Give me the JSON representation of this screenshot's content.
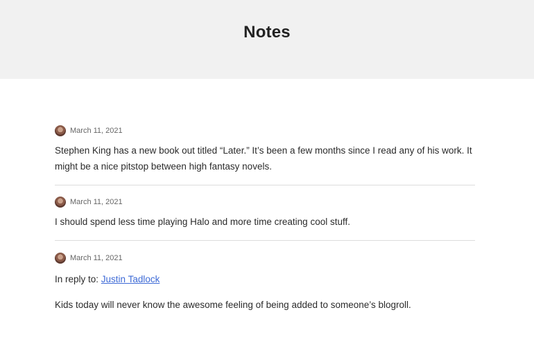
{
  "header": {
    "title": "Notes"
  },
  "notes": [
    {
      "date": "March 11, 2021",
      "text": "Stephen King has a new book out titled “Later.” It’s been a few months since I read any of his work. It might be a nice pitstop between high fantasy novels."
    },
    {
      "date": "March 11, 2021",
      "text": "I should spend less time playing Halo and more time creating cool stuff."
    },
    {
      "date": "March 11, 2021",
      "reply_prefix": "In reply to:",
      "reply_link": "Justin Tadlock",
      "text": "Kids today will never know the awesome feeling of being added to someone’s blogroll."
    }
  ],
  "colors": {
    "header_bg": "#f1f1f1",
    "link": "#3d6ad6",
    "divider": "#dcdcdc"
  },
  "icons": {
    "avatar": "author-avatar"
  }
}
